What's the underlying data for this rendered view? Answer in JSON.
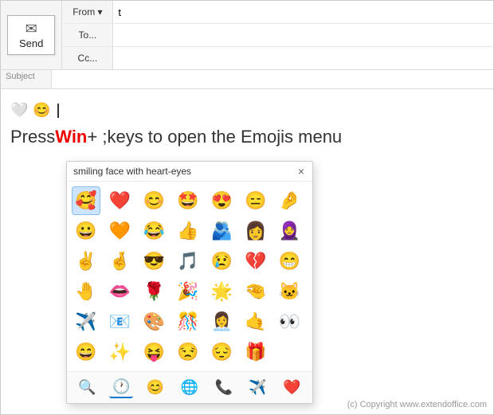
{
  "header": {
    "send_label": "Send",
    "send_icon": "✉",
    "from_label": "From ▾",
    "to_label": "To...",
    "cc_label": "Cc...",
    "subject_label": "Subject",
    "from_value": "t",
    "to_value": "",
    "cc_value": "",
    "subject_value": ""
  },
  "body": {
    "instruction_prefix": "Press ",
    "instruction_win": "Win",
    "instruction_plus": " + ; ",
    "instruction_suffix": "keys to open the Emojis menu",
    "cursor_visible": true
  },
  "emoji_picker": {
    "tooltip": "smiling face with heart-eyes",
    "close_label": "×",
    "selected_index": 0,
    "emojis": [
      "🥰",
      "❤️",
      "😊",
      "🤩",
      "😍",
      "😑",
      "🤌",
      "😀",
      "🧡",
      "😂",
      "👍",
      "🫂",
      "👩",
      "🧕",
      "✌️",
      "🤞",
      "😎",
      "🎵",
      "😢",
      "💔",
      "😁",
      "🤚",
      "👄",
      "🌹",
      "🎉",
      "🌟",
      "🤏",
      "🐱",
      "✈️",
      "📧",
      "🎨",
      "🎊",
      "👩‍💼",
      "🤙",
      "👀",
      "😄",
      "✨",
      "😝",
      "😒",
      "😔",
      "🎁"
    ],
    "footer_icons": [
      "🔍",
      "🕐",
      "😊",
      "🌐",
      "📞",
      "✈️",
      "❤️"
    ]
  },
  "copyright": "(c) Copyright www.extendoffice.com"
}
